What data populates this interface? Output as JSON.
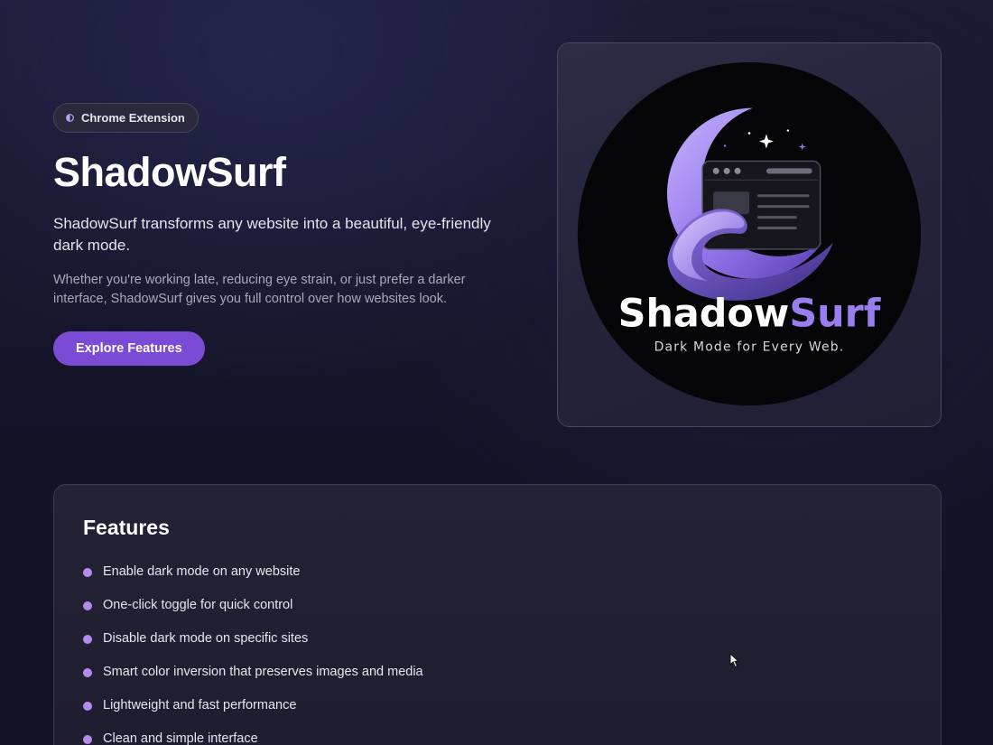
{
  "hero": {
    "badge_label": "Chrome Extension",
    "title": "ShadowSurf",
    "lead": "ShadowSurf transforms any website into a beautiful, eye-friendly dark mode.",
    "sub": "Whether you're working late, reducing eye strain, or just prefer a darker interface, ShadowSurf gives you full control over how websites look.",
    "cta_label": "Explore Features"
  },
  "logo": {
    "wordmark_part1": "Shadow",
    "wordmark_part2": "Surf",
    "tagline": "Dark Mode for Every Web."
  },
  "features": {
    "title": "Features",
    "items": [
      "Enable dark mode on any website",
      "One-click toggle for quick control",
      "Disable dark mode on specific sites",
      "Smart color inversion that preserves images and media",
      "Lightweight and fast performance",
      "Clean and simple interface"
    ]
  },
  "icons": {
    "badge": "half-moon-icon",
    "logo": "wave-moon-browser-logo",
    "bullet": "bullet-dot-icon",
    "cursor": "mouse-cursor-icon"
  },
  "colors": {
    "accent": "#7b4bd6",
    "bullet": "#b48cf0",
    "logo_purple": "#9a7ef0",
    "background": "#15152b"
  }
}
